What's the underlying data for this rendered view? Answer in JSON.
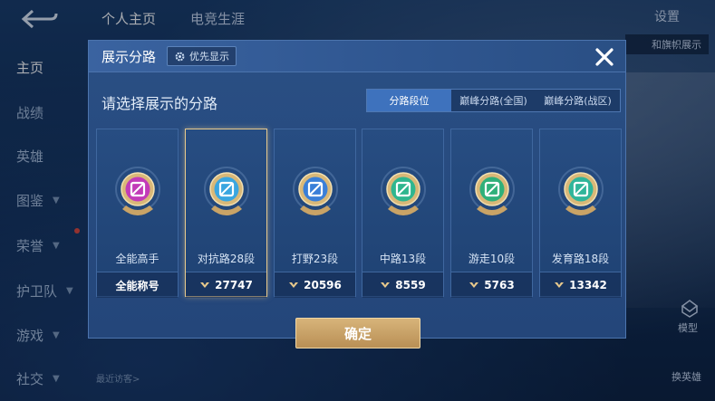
{
  "top_bar": {
    "tabs": [
      "个人主页",
      "电竞生涯"
    ],
    "settings_label": "设置",
    "right_button_label": "和旗帜展示"
  },
  "sidebar": {
    "items": [
      {
        "label": "主页",
        "has_chevron": false
      },
      {
        "label": "战绩",
        "has_chevron": false
      },
      {
        "label": "英雄",
        "has_chevron": false
      },
      {
        "label": "图鉴",
        "has_chevron": true
      },
      {
        "label": "荣誉",
        "has_chevron": true
      },
      {
        "label": "护卫队",
        "has_chevron": true
      },
      {
        "label": "游戏",
        "has_chevron": true
      },
      {
        "label": "社交",
        "has_chevron": true
      }
    ]
  },
  "dialog": {
    "title": "展示分路",
    "priority_label": "优先显示",
    "subtitle": "请选择展示的分路",
    "tabs": [
      "分路段位",
      "巅峰分路(全国)",
      "巅峰分路(战区)"
    ],
    "active_tab": 0,
    "cards": [
      {
        "label": "全能高手",
        "stat": "全能称号",
        "has_medal": false,
        "color": "#c23bb8"
      },
      {
        "label": "对抗路28段",
        "stat": "27747",
        "has_medal": true,
        "color": "#3aa6e0"
      },
      {
        "label": "打野23段",
        "stat": "20596",
        "has_medal": true,
        "color": "#3a7fd8"
      },
      {
        "label": "中路13段",
        "stat": "8559",
        "has_medal": true,
        "color": "#2fb68f"
      },
      {
        "label": "游走10段",
        "stat": "5763",
        "has_medal": true,
        "color": "#2fb07a"
      },
      {
        "label": "发育路18段",
        "stat": "13342",
        "has_medal": true,
        "color": "#2fb59a"
      }
    ],
    "selected_card": 1,
    "confirm_label": "确定"
  },
  "bottom": {
    "visitors_label": "最近访客>",
    "model_label": "模型",
    "swap_label": "换英雄"
  },
  "colors": {
    "accent_gold": "#e7c98c",
    "tab_active": "#3e72bd",
    "confirm": "#c9a366"
  }
}
